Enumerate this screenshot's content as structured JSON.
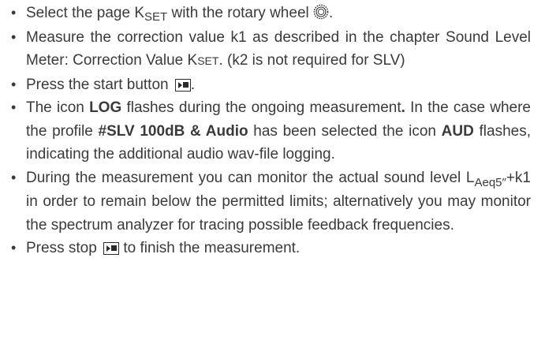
{
  "bullets": {
    "b1": {
      "pre": "Select the page ",
      "k": "K",
      "set": "SET",
      "post": " with the rotary wheel ",
      "end": ".",
      "icon": "rotary-wheel-icon"
    },
    "b2": {
      "pre": "Measure the correction value k1 as described in the chapter Sound Level Meter: Correction Value ",
      "k": "K",
      "set": "SET",
      "post": ". (k2 is not required for SLV)"
    },
    "b3": {
      "pre": "Press the start button ",
      "end": ".",
      "icon": "start-stop-button-icon"
    },
    "b4": {
      "t1": "The icon ",
      "log": "LOG",
      "t2": " flashes during the ongoing measurement",
      "dot": ".",
      "t3": " In the case where the profile ",
      "profile": "#SLV 100dB & Audio",
      "t4": " has been selected the icon ",
      "aud": "AUD",
      "t5": " flashes, indicating the additional audio wav-file logging."
    },
    "b5": {
      "pre": "During the measurement you can monitor the actual sound level L",
      "sub": "Aeq5″",
      "post": "+k1 in order to remain below the permitted limits; alternatively you may monitor the spectrum analyzer for tracing possible feedback frequencies."
    },
    "b6": {
      "pre": "Press stop ",
      "post": " to finish the measurement.",
      "icon": "start-stop-button-icon"
    }
  },
  "colors": {
    "text": "#3a3a3a",
    "icon": "#2b2b2b"
  }
}
